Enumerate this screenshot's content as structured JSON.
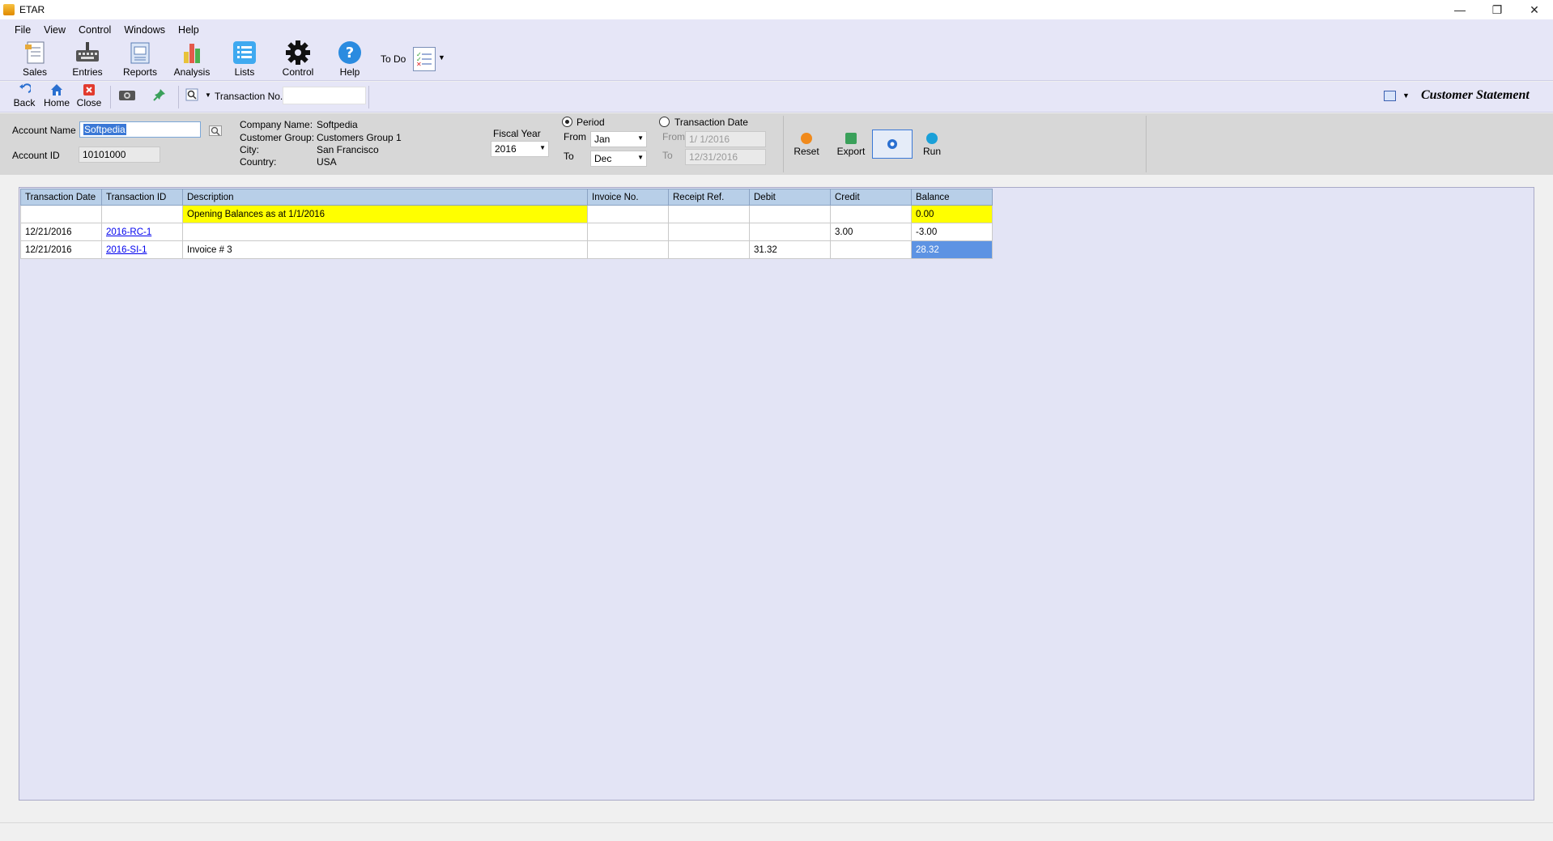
{
  "window": {
    "title": "ETAR"
  },
  "menu": [
    "File",
    "View",
    "Control",
    "Windows",
    "Help"
  ],
  "ribbon": {
    "sales": "Sales",
    "entries": "Entries",
    "reports": "Reports",
    "analysis": "Analysis",
    "lists": "Lists",
    "control": "Control",
    "help": "Help",
    "todo": "To Do"
  },
  "toolbar": {
    "back": "Back",
    "home": "Home",
    "close": "Close",
    "transaction_no_label": "Transaction No.",
    "transaction_no_value": "",
    "page_title": "Customer Statement"
  },
  "filter": {
    "account_name_label": "Account Name",
    "account_name_value": "Softpedia",
    "account_id_label": "Account ID",
    "account_id_value": "10101000",
    "company_name_label": "Company Name:",
    "company_name_value": "Softpedia",
    "customer_group_label": "Customer Group:",
    "customer_group_value": "Customers Group 1",
    "city_label": "City:",
    "city_value": "San Francisco",
    "country_label": "Country:",
    "country_value": "USA",
    "fiscal_year_label": "Fiscal Year",
    "fiscal_year_value": "2016",
    "period_label": "Period",
    "transaction_date_label": "Transaction Date",
    "from_label": "From",
    "to_label": "To",
    "from_month": "Jan",
    "to_month": "Dec",
    "from_date": "1/ 1/2016",
    "to_date": "12/31/2016",
    "reset": "Reset",
    "export": "Export",
    "run": "Run"
  },
  "grid": {
    "columns": [
      "Transaction Date",
      "Transaction ID",
      "Description",
      "Invoice No.",
      "Receipt Ref.",
      "Debit",
      "Credit",
      "Balance"
    ],
    "rows": [
      [
        "",
        "",
        "Opening Balances as at 1/1/2016",
        "",
        "",
        "",
        "",
        "0.00"
      ],
      [
        "12/21/2016",
        "2016-RC-1",
        "",
        "",
        "",
        "",
        "3.00",
        "-3.00"
      ],
      [
        "12/21/2016",
        "2016-SI-1",
        "Invoice # 3",
        "",
        "",
        "31.32",
        "",
        "28.32"
      ]
    ]
  },
  "colors": {
    "highlight": "#ffff00",
    "selection": "#5d93e3",
    "header": "#b8cfe8",
    "accent": "#3a78d6"
  }
}
